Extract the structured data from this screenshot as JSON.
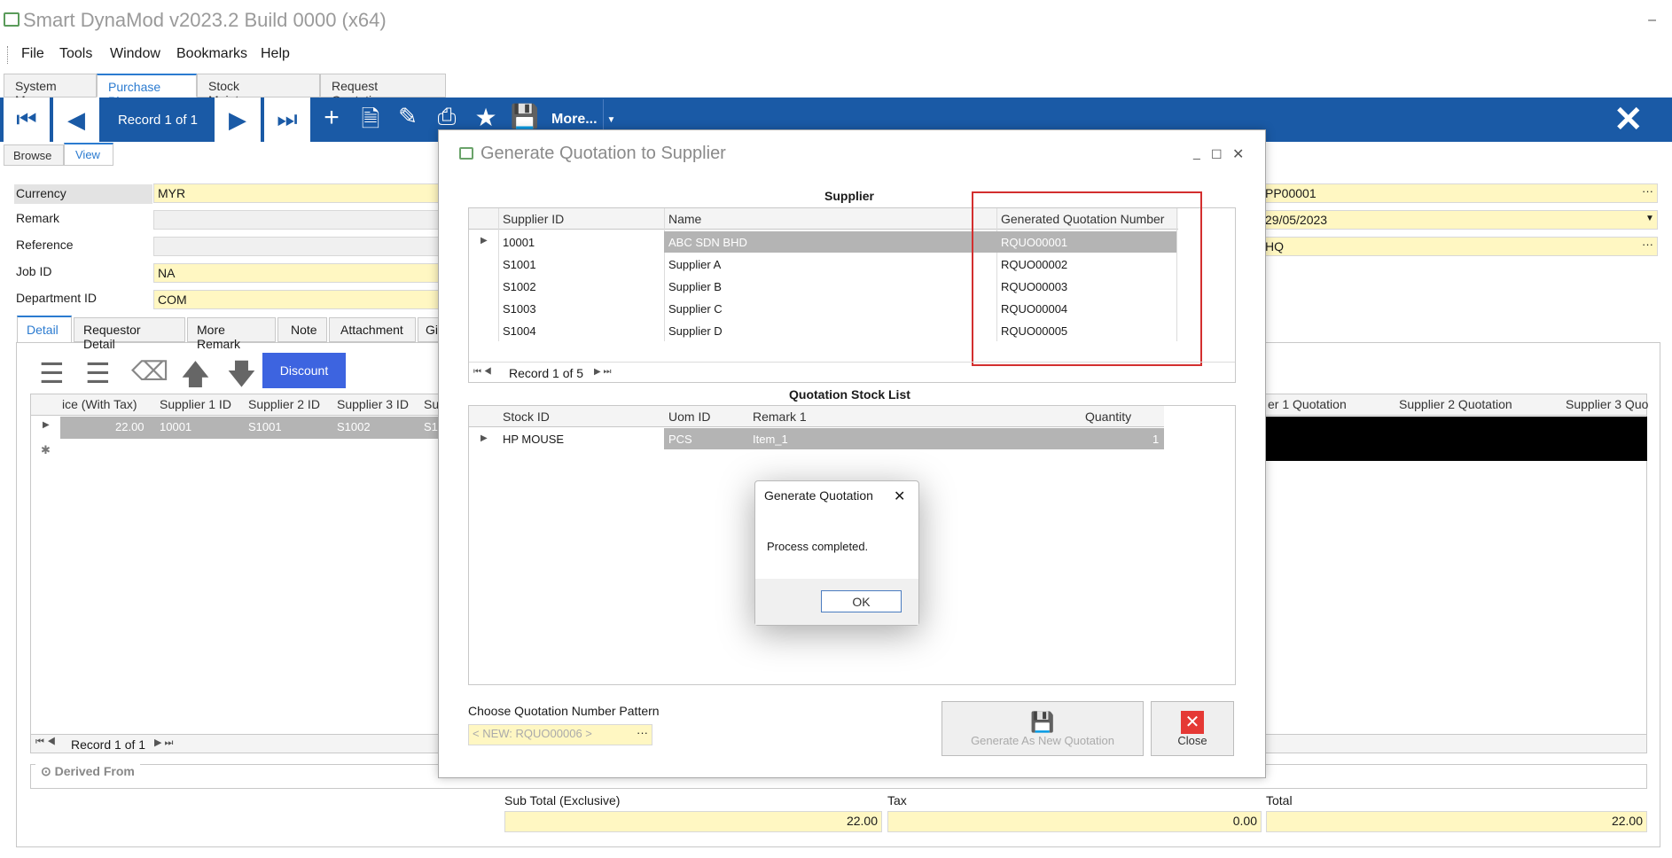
{
  "app": {
    "title": "Smart DynaMod v2023.2 Build 0000 (x64)"
  },
  "menu": [
    "File",
    "Tools",
    "Window",
    "Bookmarks",
    "Help"
  ],
  "tabs": [
    "System Menu",
    "Purchase Plan",
    "Stock Maintenance",
    "Request Quotation"
  ],
  "toolbar": {
    "record": "Record 1 of 1",
    "more": "More..."
  },
  "viewtabs": [
    "Browse",
    "View"
  ],
  "form": {
    "currency_label": "Currency",
    "currency": "MYR",
    "remark_label": "Remark",
    "reference_label": "Reference",
    "jobid_label": "Job ID",
    "jobid": "NA",
    "dept_label": "Department ID",
    "dept": "COM",
    "right": [
      "PP00001",
      "29/05/2023",
      "HQ"
    ]
  },
  "detailtabs": [
    "Detail",
    "Requestor Detail",
    "More Remark",
    "Note",
    "Attachment",
    "Gi"
  ],
  "detail": {
    "discount": "Discount",
    "headers": [
      "ice (With Tax)",
      "Supplier 1 ID",
      "Supplier 2 ID",
      "Supplier 3 ID",
      "Su"
    ],
    "row": [
      "22.00",
      "10001",
      "S1001",
      "S1002",
      "S1"
    ],
    "right_headers": [
      "er 1 Quotation",
      "Supplier 2 Quotation",
      "Supplier 3 Quo"
    ],
    "nav": "Record 1 of 1",
    "derived": "Derived From"
  },
  "totals": {
    "sub_label": "Sub Total (Exclusive)",
    "sub": "22.00",
    "tax_label": "Tax",
    "tax": "0.00",
    "total_label": "Total",
    "total": "22.00"
  },
  "dialog": {
    "title": "Generate Quotation to Supplier",
    "supplier_caption": "Supplier",
    "supplier_headers": [
      "Supplier ID",
      "Name",
      "Generated Quotation Number"
    ],
    "suppliers": [
      {
        "id": "10001",
        "name": "ABC SDN BHD",
        "q": "RQUO00001"
      },
      {
        "id": "S1001",
        "name": "Supplier A",
        "q": "RQUO00002"
      },
      {
        "id": "S1002",
        "name": "Supplier B",
        "q": "RQUO00003"
      },
      {
        "id": "S1003",
        "name": "Supplier C",
        "q": "RQUO00004"
      },
      {
        "id": "S1004",
        "name": "Supplier D",
        "q": "RQUO00005"
      }
    ],
    "supplier_nav": "Record 1 of 5",
    "stock_caption": "Quotation Stock List",
    "stock_headers": [
      "Stock ID",
      "Uom ID",
      "Remark 1",
      "Quantity"
    ],
    "stock_row": {
      "id": "HP MOUSE",
      "uom": "PCS",
      "remark": "Item_1",
      "qty": "1"
    },
    "pattern_label": "Choose Quotation Number Pattern",
    "pattern_value": "< NEW: RQUO00006 >",
    "gen_button": "Generate As New Quotation",
    "close_button": "Close"
  },
  "message": {
    "title": "Generate Quotation",
    "text": "Process completed.",
    "ok": "OK"
  },
  "colors": {
    "accent": "#1a5aa6",
    "highlight": "#d32f2f"
  }
}
